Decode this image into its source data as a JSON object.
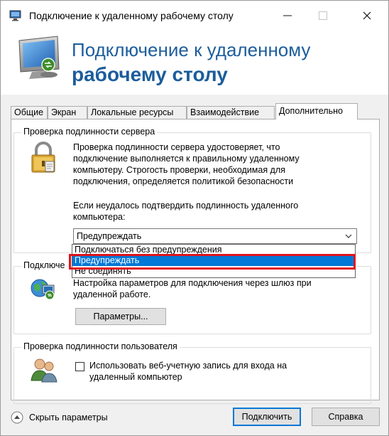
{
  "window": {
    "title": "Подключение к удаленному рабочему столу",
    "controls": {
      "minimize": "—",
      "maximize": "☐",
      "close": "✕"
    }
  },
  "banner": {
    "line1": "Подключение к удаленному",
    "line2": "рабочему столу"
  },
  "tabs": [
    {
      "label": "Общие"
    },
    {
      "label": "Экран"
    },
    {
      "label": "Локальные ресурсы"
    },
    {
      "label": "Взаимодействие"
    },
    {
      "label": "Дополнительно",
      "active": true
    }
  ],
  "server_auth": {
    "title": "Проверка подлинности сервера",
    "description": [
      "Проверка подлинности сервера удостоверяет, что",
      "подключение выполняется к правильному удаленному",
      "компьютеру. Строгость проверки, необходимая для",
      "подключения, определяется политикой безопасности"
    ],
    "prompt": [
      "Если неудалось подтвердить подлинность удаленного",
      "компьютера:"
    ],
    "selected": "Предупреждать",
    "options": [
      "Подключаться без предупреждения",
      "Предупреждать",
      "Не соединять"
    ],
    "highlighted_option": "Предупреждать"
  },
  "gateway": {
    "title_partial": "Подключе",
    "description": [
      "Настройка параметров для подключения через шлюз при",
      "удаленной работе."
    ],
    "settings_button": "Параметры..."
  },
  "user_auth": {
    "title": "Проверка подлинности пользователя",
    "checkbox_label": [
      "Использовать веб-учетную запись для входа на",
      "удаленный компьютер"
    ],
    "checked": false
  },
  "footer": {
    "hide_options": "Скрыть параметры",
    "connect": "Подключить",
    "help": "Справка"
  },
  "colors": {
    "accent": "#1c5d9c",
    "selection": "#0078d7",
    "highlight_border": "#e0141e"
  }
}
